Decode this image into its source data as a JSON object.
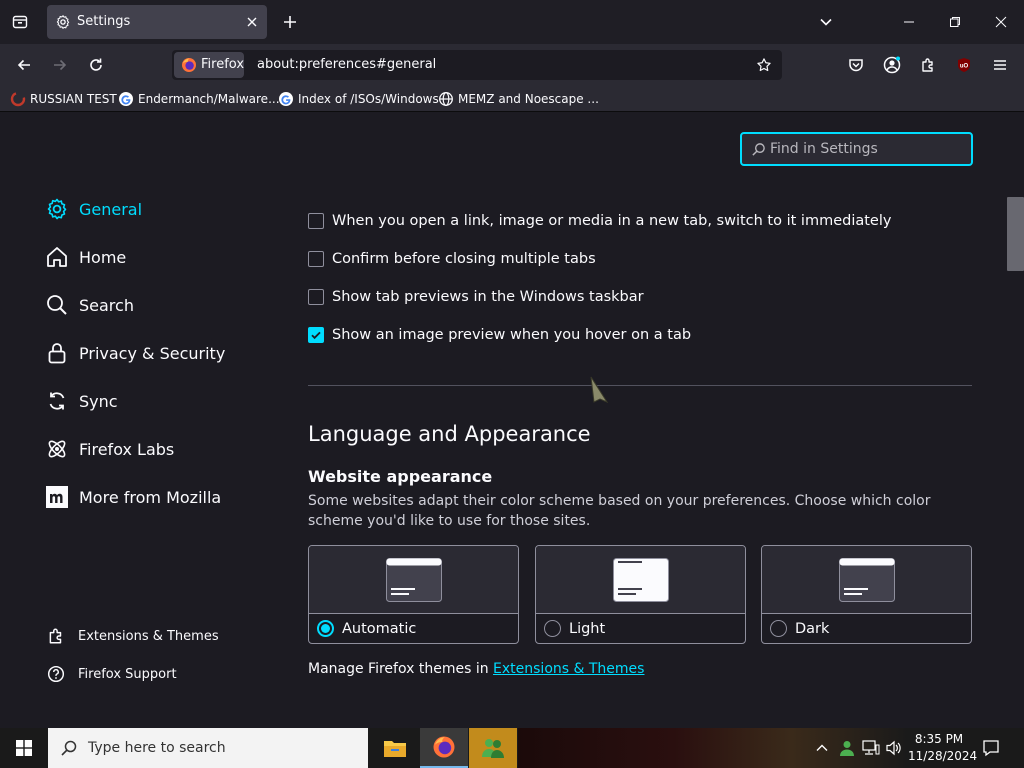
{
  "tab": {
    "title": "Settings"
  },
  "navbar": {
    "identity_label": "Firefox",
    "url": "about:preferences#general"
  },
  "bookmarks": [
    {
      "label": "RUSSIAN TEST"
    },
    {
      "label": "Endermanch/Malware..."
    },
    {
      "label": "Index of /ISOs/Windows"
    },
    {
      "label": "MEMZ and Noescape ..."
    }
  ],
  "search": {
    "placeholder": "Find in Settings"
  },
  "sidebar": {
    "categories": [
      {
        "label": "General",
        "icon": "gear-icon",
        "active": true
      },
      {
        "label": "Home",
        "icon": "home-icon"
      },
      {
        "label": "Search",
        "icon": "search-icon"
      },
      {
        "label": "Privacy & Security",
        "icon": "lock-icon"
      },
      {
        "label": "Sync",
        "icon": "sync-icon"
      },
      {
        "label": "Firefox Labs",
        "icon": "labs-icon"
      },
      {
        "label": "More from Mozilla",
        "icon": "mozilla-icon"
      }
    ],
    "footer": [
      {
        "label": "Extensions & Themes",
        "icon": "puzzle-icon"
      },
      {
        "label": "Firefox Support",
        "icon": "help-icon"
      }
    ]
  },
  "tabs_settings": [
    {
      "label": "When you open a link, image or media in a new tab, switch to it immediately",
      "checked": false
    },
    {
      "label": "Confirm before closing multiple tabs",
      "checked": false
    },
    {
      "label": "Show tab previews in the Windows taskbar",
      "checked": false
    },
    {
      "label": "Show an image preview when you hover on a tab",
      "checked": true
    }
  ],
  "language_appearance": {
    "heading": "Language and Appearance",
    "subheading": "Website appearance",
    "description": "Some websites adapt their color scheme based on your preferences. Choose which color scheme you'd like to use for those sites.",
    "options": [
      {
        "label": "Automatic",
        "selected": true
      },
      {
        "label": "Light",
        "selected": false
      },
      {
        "label": "Dark",
        "selected": false
      }
    ],
    "manage_text": "Manage Firefox themes in ",
    "manage_link": "Extensions & Themes"
  },
  "taskbar": {
    "search_placeholder": "Type here to search",
    "time": "8:35 PM",
    "date": "11/28/2024"
  },
  "colors": {
    "accent": "#00ddff",
    "background": "#1c1b22",
    "toolbar": "#2b2a33"
  }
}
